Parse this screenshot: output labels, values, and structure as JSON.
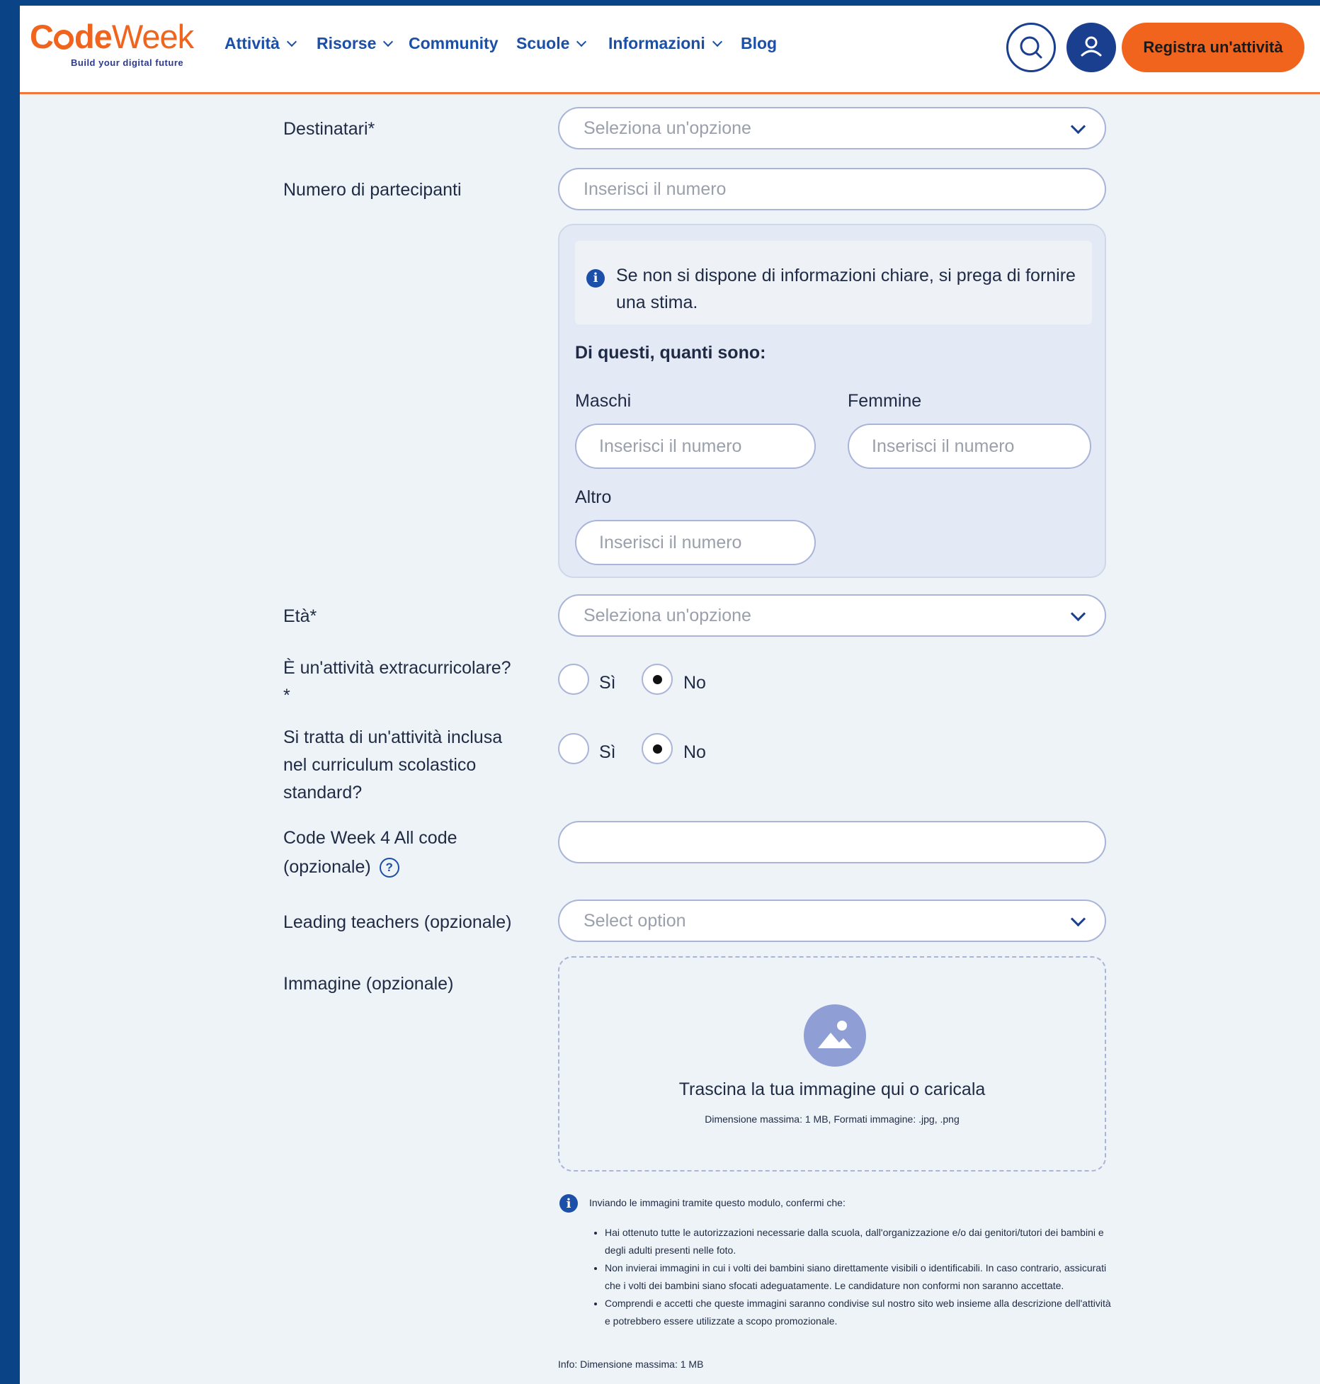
{
  "header": {
    "logo_part1": "C",
    "logo_part2": "de",
    "logo_part3": "Week",
    "logo_tagline": "Build your digital future",
    "nav": [
      {
        "label": "Attività",
        "dropdown": true
      },
      {
        "label": "Risorse",
        "dropdown": true
      },
      {
        "label": "Community",
        "dropdown": false
      },
      {
        "label": "Scuole",
        "dropdown": true
      },
      {
        "label": "Informazioni",
        "dropdown": true
      },
      {
        "label": "Blog",
        "dropdown": false
      }
    ],
    "register_label": "Registra un'attività"
  },
  "form": {
    "audience": {
      "label": "Destinatari*",
      "placeholder": "Seleziona un'opzione"
    },
    "participants": {
      "label": "Numero di partecipanti",
      "placeholder": "Inserisci il numero"
    },
    "estimate_notice": "Se non si dispone di informazioni chiare, si prega di fornire una stima.",
    "breakdown_title": "Di questi, quanti sono:",
    "males": {
      "label": "Maschi",
      "placeholder": "Inserisci il numero"
    },
    "females": {
      "label": "Femmine",
      "placeholder": "Inserisci il numero"
    },
    "other": {
      "label": "Altro",
      "placeholder": "Inserisci il numero"
    },
    "age": {
      "label": "Età*",
      "placeholder": "Seleziona un'opzione"
    },
    "extracurricular": {
      "label": "È un'attività extracurricolare?",
      "required_mark": "*",
      "yes": "Sì",
      "no": "No",
      "selected": "No"
    },
    "curriculum": {
      "label_line1": "Si tratta di un'attività inclusa",
      "label_line2": "nel curriculum scolastico",
      "label_line3": "standard?",
      "yes": "Sì",
      "no": "No",
      "selected": "No"
    },
    "codeweek4all": {
      "label_line1": "Code Week 4 All code",
      "label_line2": "(opzionale)",
      "value": ""
    },
    "leading_teachers": {
      "label": "Leading teachers (opzionale)",
      "placeholder": "Select option"
    },
    "image": {
      "label": "Immagine (opzionale)",
      "drop_title": "Trascina la tua immagine qui o caricala",
      "drop_hint": "Dimensione massima: 1 MB, Formati immagine: .jpg, .png"
    },
    "consent": {
      "intro": "Inviando le immagini tramite questo modulo, confermi che:",
      "items": [
        "Hai ottenuto tutte le autorizzazioni necessarie dalla scuola, dall'organizzazione e/o dai genitori/tutori dei bambini e degli adulti presenti nelle foto.",
        "Non invierai immagini in cui i volti dei bambini siano direttamente visibili o identificabili. In caso contrario, assicurati che i volti dei bambini siano sfocati adeguatamente. Le candidature non conformi non saranno accettate.",
        "Comprendi e accetti che queste immagini saranno condivise sul nostro sito web insieme alla descrizione dell'attività e potrebbero essere utilizzate a scopo promozionale."
      ]
    },
    "size_info": "Info: Dimensione massima: 1 MB"
  },
  "colors": {
    "brand_orange": "#f0641e",
    "brand_blue": "#1b3f8f",
    "page_bg": "#eef3f8"
  }
}
